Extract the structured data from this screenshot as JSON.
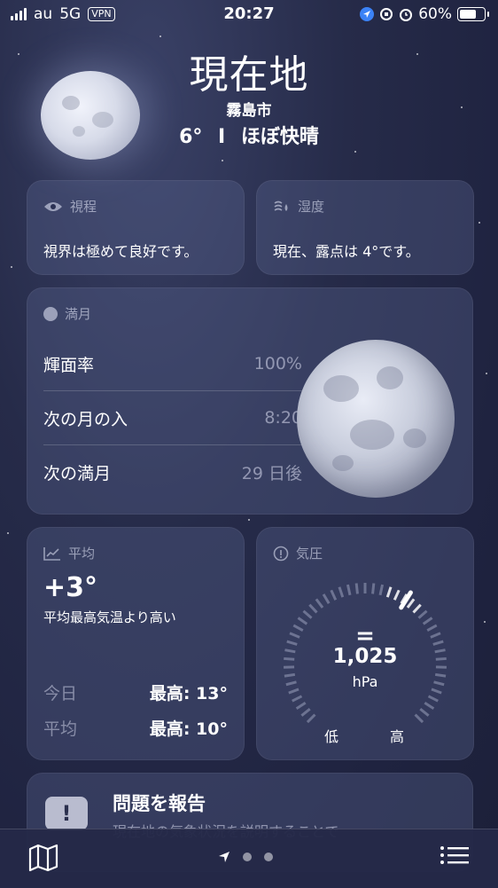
{
  "status_bar": {
    "carrier": "au",
    "network": "5G",
    "vpn": "VPN",
    "time": "20:27",
    "battery": "60%"
  },
  "header": {
    "location": "現在地",
    "city": "霧島市",
    "temperature": "6°",
    "separator": "I",
    "condition": "ほぼ快晴"
  },
  "visibility": {
    "title": "視程",
    "text": "視界は極めて良好です。"
  },
  "humidity": {
    "title": "湿度",
    "text": "現在、露点は 4°です。"
  },
  "moon": {
    "title": "満月",
    "rows": [
      {
        "label": "輝面率",
        "value": "100%"
      },
      {
        "label": "次の月の入",
        "value": "8:20"
      },
      {
        "label": "次の満月",
        "value": "29 日後"
      }
    ]
  },
  "average": {
    "title": "平均",
    "value": "+3°",
    "description": "平均最高気温より高い",
    "rows": [
      {
        "label": "今日",
        "value": "最高: 13°"
      },
      {
        "label": "平均",
        "value": "最高: 10°"
      }
    ]
  },
  "pressure": {
    "title": "気圧",
    "trend": "=",
    "value": "1,025",
    "unit": "hPa",
    "low_label": "低",
    "high_label": "高",
    "level": 0.62
  },
  "report": {
    "title": "問題を報告",
    "description": "現在地の気象状況を説明することで"
  },
  "icons": {
    "visibility": "eye-icon",
    "humidity": "humidity-icon",
    "moon": "moon-phase-icon",
    "average": "trend-chart-icon",
    "pressure": "gauge-icon",
    "report": "exclamation-icon",
    "map": "map-icon",
    "location": "location-arrow-icon",
    "list": "list-icon"
  }
}
